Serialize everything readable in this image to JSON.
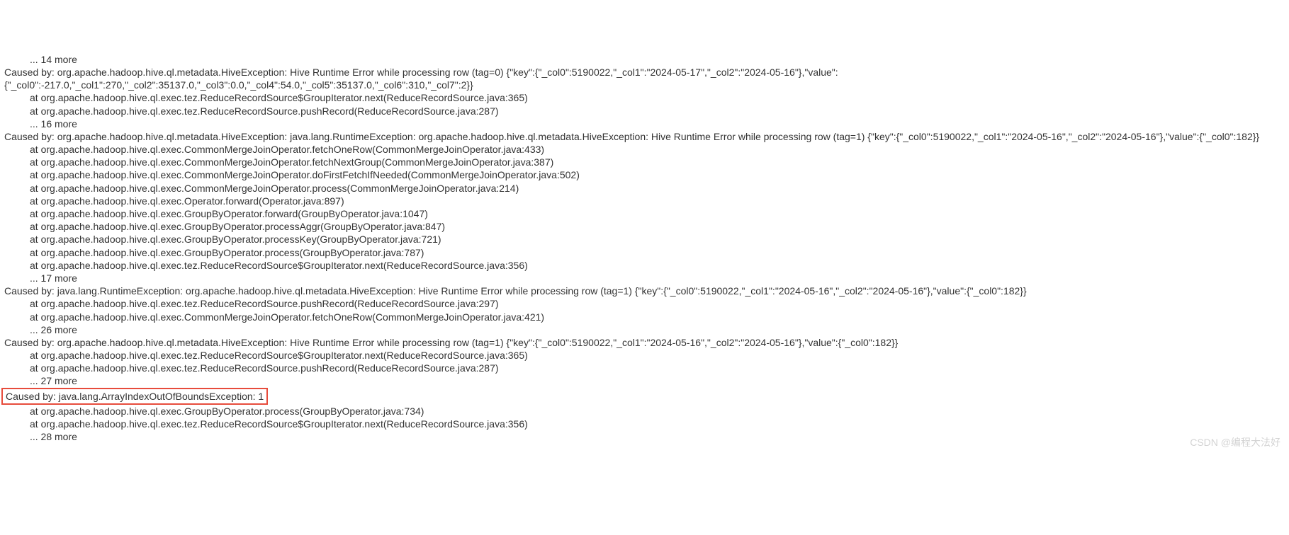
{
  "lines": [
    {
      "indent": 1,
      "text": "... 14 more"
    },
    {
      "indent": 0,
      "text": "Caused by: org.apache.hadoop.hive.ql.metadata.HiveException: Hive Runtime Error while processing row (tag=0) {\"key\":{\"_col0\":5190022,\"_col1\":\"2024-05-17\",\"_col2\":\"2024-05-16\"},\"value\":{\"_col0\":-217.0,\"_col1\":270,\"_col2\":35137.0,\"_col3\":0.0,\"_col4\":54.0,\"_col5\":35137.0,\"_col6\":310,\"_col7\":2}}"
    },
    {
      "indent": 1,
      "text": "at org.apache.hadoop.hive.ql.exec.tez.ReduceRecordSource$GroupIterator.next(ReduceRecordSource.java:365)"
    },
    {
      "indent": 1,
      "text": "at org.apache.hadoop.hive.ql.exec.tez.ReduceRecordSource.pushRecord(ReduceRecordSource.java:287)"
    },
    {
      "indent": 1,
      "text": "... 16 more"
    },
    {
      "indent": 0,
      "text": "Caused by: org.apache.hadoop.hive.ql.metadata.HiveException: java.lang.RuntimeException: org.apache.hadoop.hive.ql.metadata.HiveException: Hive Runtime Error while processing row (tag=1) {\"key\":{\"_col0\":5190022,\"_col1\":\"2024-05-16\",\"_col2\":\"2024-05-16\"},\"value\":{\"_col0\":182}}"
    },
    {
      "indent": 1,
      "text": "at org.apache.hadoop.hive.ql.exec.CommonMergeJoinOperator.fetchOneRow(CommonMergeJoinOperator.java:433)"
    },
    {
      "indent": 1,
      "text": "at org.apache.hadoop.hive.ql.exec.CommonMergeJoinOperator.fetchNextGroup(CommonMergeJoinOperator.java:387)"
    },
    {
      "indent": 1,
      "text": "at org.apache.hadoop.hive.ql.exec.CommonMergeJoinOperator.doFirstFetchIfNeeded(CommonMergeJoinOperator.java:502)"
    },
    {
      "indent": 1,
      "text": "at org.apache.hadoop.hive.ql.exec.CommonMergeJoinOperator.process(CommonMergeJoinOperator.java:214)"
    },
    {
      "indent": 1,
      "text": "at org.apache.hadoop.hive.ql.exec.Operator.forward(Operator.java:897)"
    },
    {
      "indent": 1,
      "text": "at org.apache.hadoop.hive.ql.exec.GroupByOperator.forward(GroupByOperator.java:1047)"
    },
    {
      "indent": 1,
      "text": "at org.apache.hadoop.hive.ql.exec.GroupByOperator.processAggr(GroupByOperator.java:847)"
    },
    {
      "indent": 1,
      "text": "at org.apache.hadoop.hive.ql.exec.GroupByOperator.processKey(GroupByOperator.java:721)"
    },
    {
      "indent": 1,
      "text": "at org.apache.hadoop.hive.ql.exec.GroupByOperator.process(GroupByOperator.java:787)"
    },
    {
      "indent": 1,
      "text": "at org.apache.hadoop.hive.ql.exec.tez.ReduceRecordSource$GroupIterator.next(ReduceRecordSource.java:356)"
    },
    {
      "indent": 1,
      "text": "... 17 more"
    },
    {
      "indent": 0,
      "text": "Caused by: java.lang.RuntimeException: org.apache.hadoop.hive.ql.metadata.HiveException: Hive Runtime Error while processing row (tag=1) {\"key\":{\"_col0\":5190022,\"_col1\":\"2024-05-16\",\"_col2\":\"2024-05-16\"},\"value\":{\"_col0\":182}}"
    },
    {
      "indent": 1,
      "text": "at org.apache.hadoop.hive.ql.exec.tez.ReduceRecordSource.pushRecord(ReduceRecordSource.java:297)"
    },
    {
      "indent": 1,
      "text": "at org.apache.hadoop.hive.ql.exec.CommonMergeJoinOperator.fetchOneRow(CommonMergeJoinOperator.java:421)"
    },
    {
      "indent": 1,
      "text": "... 26 more"
    },
    {
      "indent": 0,
      "text": "Caused by: org.apache.hadoop.hive.ql.metadata.HiveException: Hive Runtime Error while processing row (tag=1) {\"key\":{\"_col0\":5190022,\"_col1\":\"2024-05-16\",\"_col2\":\"2024-05-16\"},\"value\":{\"_col0\":182}}"
    },
    {
      "indent": 1,
      "text": "at org.apache.hadoop.hive.ql.exec.tez.ReduceRecordSource$GroupIterator.next(ReduceRecordSource.java:365)"
    },
    {
      "indent": 1,
      "text": "at org.apache.hadoop.hive.ql.exec.tez.ReduceRecordSource.pushRecord(ReduceRecordSource.java:287)"
    },
    {
      "indent": 1,
      "text": "... 27 more"
    },
    {
      "indent": 0,
      "highlight": true,
      "text": "Caused by: java.lang.ArrayIndexOutOfBoundsException: 1"
    },
    {
      "indent": 1,
      "text": "at org.apache.hadoop.hive.ql.exec.GroupByOperator.process(GroupByOperator.java:734)"
    },
    {
      "indent": 1,
      "text": "at org.apache.hadoop.hive.ql.exec.tez.ReduceRecordSource$GroupIterator.next(ReduceRecordSource.java:356)"
    },
    {
      "indent": 1,
      "text": "... 28 more"
    }
  ],
  "watermark": "CSDN @编程大法好"
}
